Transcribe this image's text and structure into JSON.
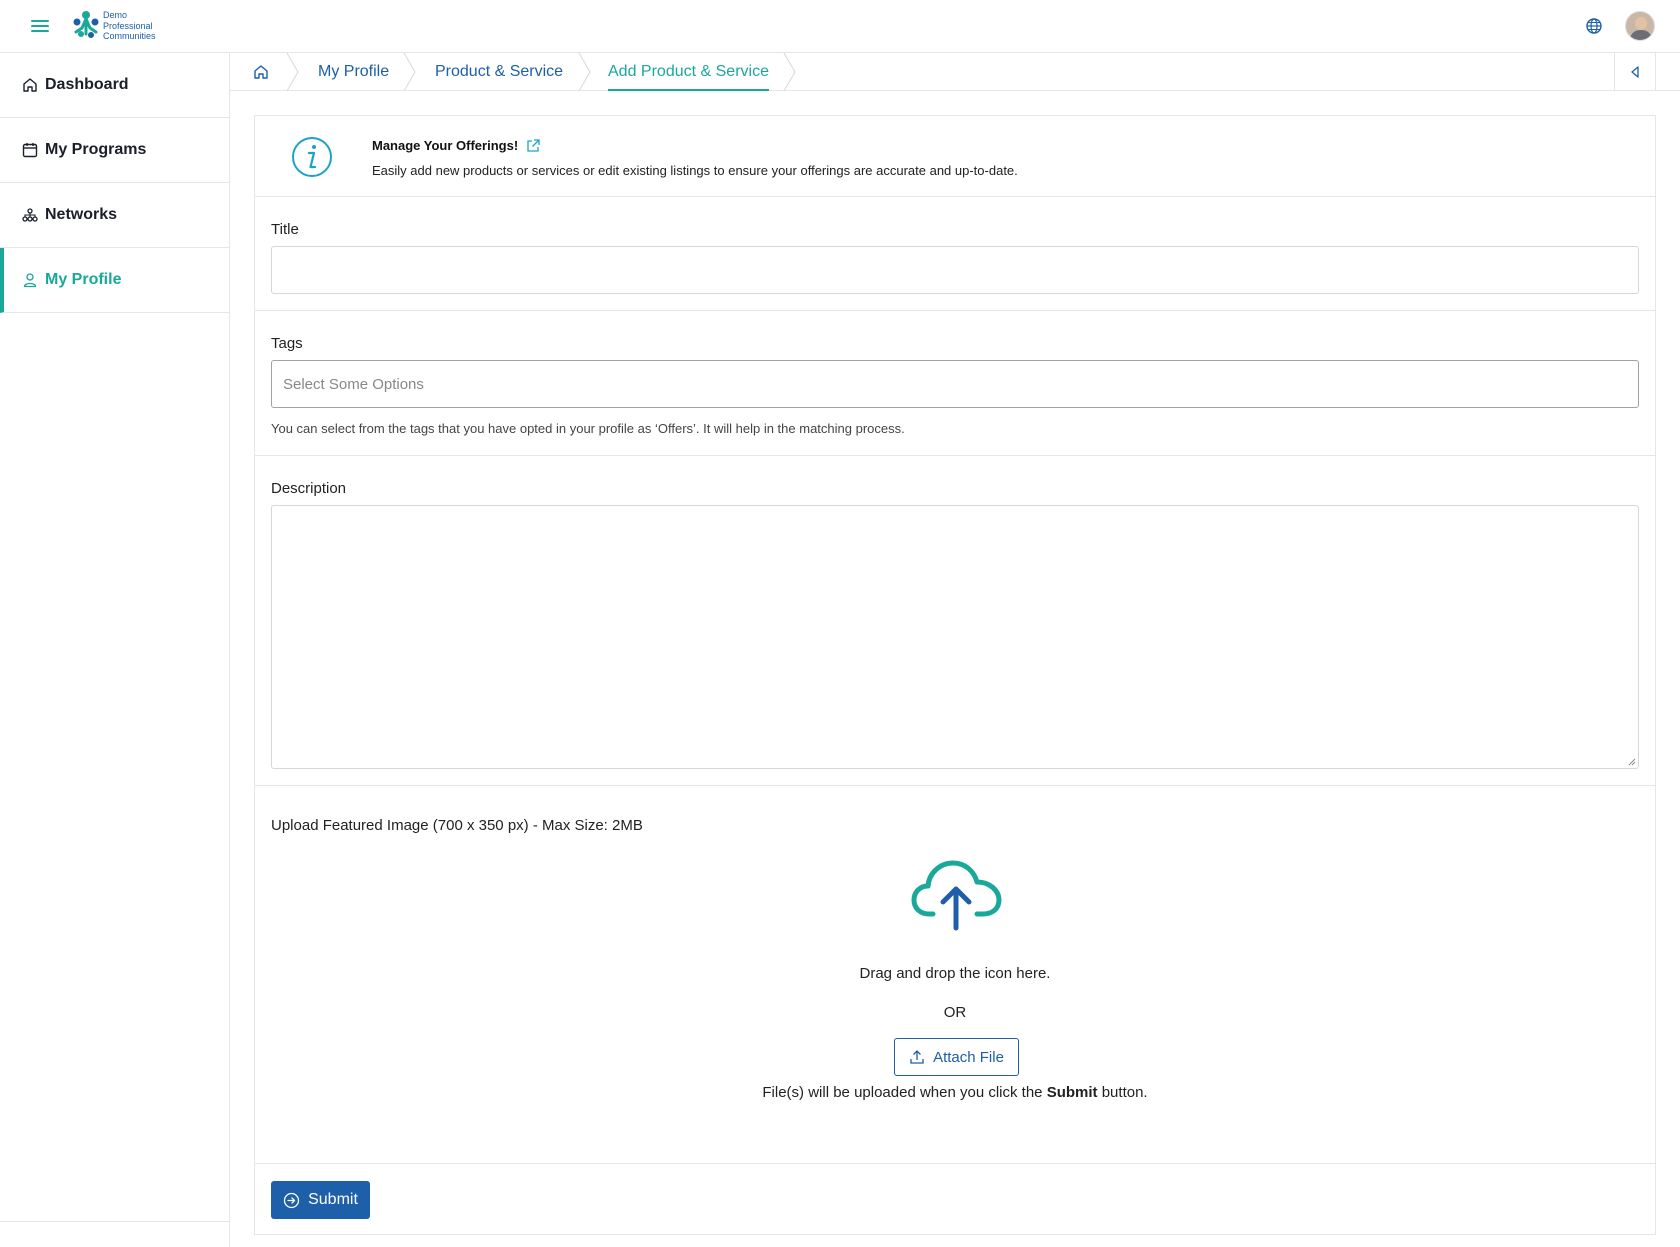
{
  "app": {
    "logo_lines": [
      "Demo",
      "Professional",
      "Communities"
    ]
  },
  "sidebar": {
    "items": [
      {
        "label": "Dashboard",
        "icon": "home-icon"
      },
      {
        "label": "My Programs",
        "icon": "calendar-icon"
      },
      {
        "label": "Networks",
        "icon": "network-icon"
      },
      {
        "label": "My Profile",
        "icon": "user-icon",
        "active": true
      }
    ]
  },
  "breadcrumb": {
    "items": [
      "My Profile",
      "Product & Service",
      "Add Product & Service"
    ],
    "active_index": 2
  },
  "info": {
    "title": "Manage Your Offerings!",
    "description": "Easily add new products or services or edit existing listings to ensure your offerings are accurate and up-to-date."
  },
  "form": {
    "title_label": "Title",
    "title_value": "",
    "tags_label": "Tags",
    "tags_placeholder": "Select Some Options",
    "tags_helper": "You can select from the tags that you have opted in your profile as ‘Offers’. It will help in the matching process.",
    "description_label": "Description",
    "description_value": "",
    "upload_label": "Upload Featured Image (700 x 350 px) - Max Size: 2MB",
    "drag_text": "Drag and drop the icon here.",
    "or_text": "OR",
    "attach_label": "Attach File",
    "note_prefix": "File(s) will be uploaded when you click the ",
    "note_bold": "Submit",
    "note_suffix": " button.",
    "submit_label": "Submit"
  },
  "colors": {
    "accent": "#1aa89a",
    "primary": "#1d5fa8",
    "border": "#e3e6ea"
  }
}
